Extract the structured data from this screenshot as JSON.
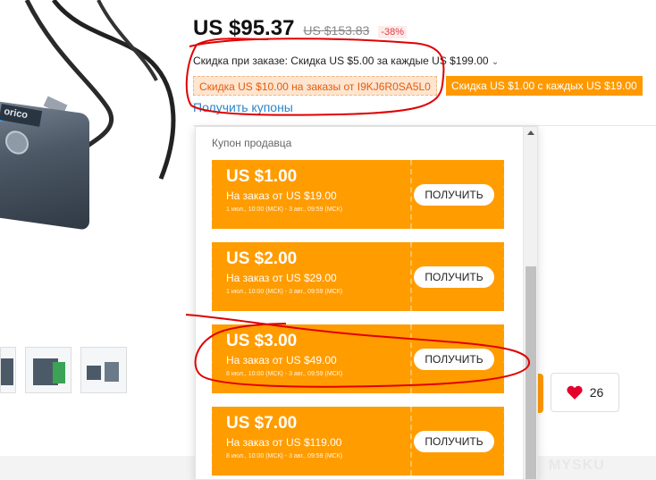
{
  "product": {
    "logo_text": "orico"
  },
  "price": {
    "current": "US $95.37",
    "original": "US $153.83",
    "discount_percent": "-38%"
  },
  "store_discount": {
    "text": "Скидка при заказе: Скидка US $5.00 за каждые US $199.00"
  },
  "promos": [
    {
      "label": "Скидка US $10.00 на заказы от I9KJ6R0SA5L0"
    },
    {
      "label": "Скидка US $1.00 с каждых US $19.00"
    }
  ],
  "get_coupons_label": "Получить купоны",
  "popup": {
    "title": "Купон продавца",
    "coupons": [
      {
        "amount": "US $1.00",
        "condition": "На заказ от US $19.00",
        "dates": "1 июл., 10:00 (МСК) - 3 авг., 09:59 (МСК)",
        "button": "ПОЛУЧИТЬ"
      },
      {
        "amount": "US $2.00",
        "condition": "На заказ от US $29.00",
        "dates": "1 июл., 10:00 (МСК) - 3 авг., 09:59 (МСК)",
        "button": "ПОЛУЧИТЬ"
      },
      {
        "amount": "US $3.00",
        "condition": "На заказ от US $49.00",
        "dates": "8 июл., 10:00 (МСК) - 3 авг., 09:59 (МСК)",
        "button": "ПОЛУЧИТЬ"
      },
      {
        "amount": "US $7.00",
        "condition": "На заказ от US $119.00",
        "dates": "8 июл., 10:00 (МСК) - 3 авг., 09:59 (МСК)",
        "button": "ПОЛУЧИТЬ"
      }
    ]
  },
  "wishlist": {
    "count": "26",
    "icon": "heart-icon",
    "color": "#e4002b"
  },
  "colors": {
    "coupon_orange": "#ff9c00",
    "annotation_red": "#e00000",
    "link_blue": "#2a86c9"
  },
  "watermark": "MYSKU"
}
